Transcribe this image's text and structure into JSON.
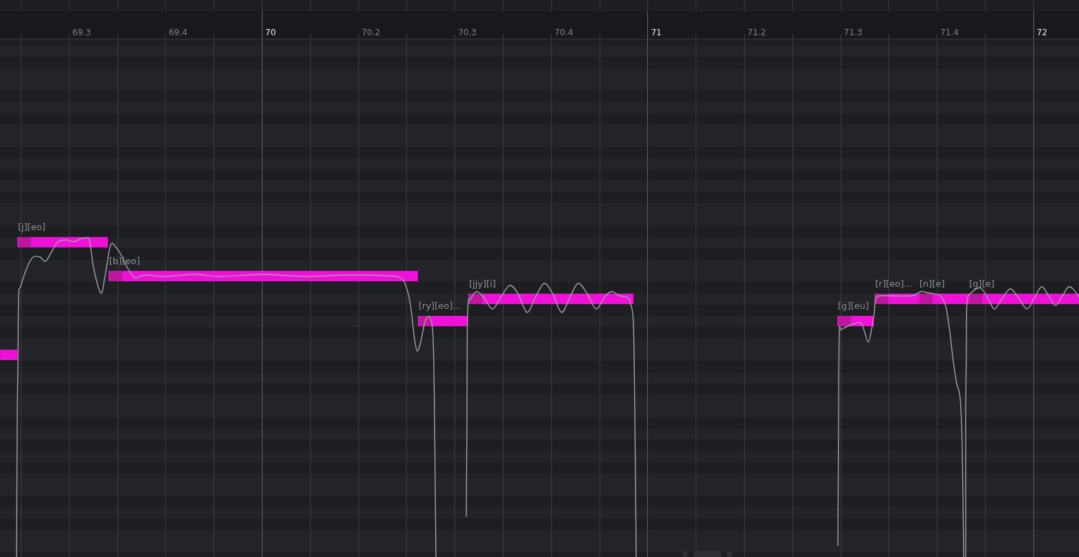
{
  "ruler": {
    "labels": [
      {
        "text": "69.3",
        "kind": "beat"
      },
      {
        "text": "69.4",
        "kind": "beat"
      },
      {
        "text": "70",
        "kind": "bar"
      },
      {
        "text": "70.2",
        "kind": "beat"
      },
      {
        "text": "70.3",
        "kind": "beat"
      },
      {
        "text": "70.4",
        "kind": "beat"
      },
      {
        "text": "71",
        "kind": "bar"
      },
      {
        "text": "71.2",
        "kind": "beat"
      },
      {
        "text": "71.3",
        "kind": "beat"
      },
      {
        "text": "71.4",
        "kind": "beat"
      },
      {
        "text": "72",
        "kind": "bar"
      }
    ]
  },
  "notes": [
    {
      "kind": "note"
    },
    {
      "kind": "note",
      "lyric": "[j][eo]"
    },
    {
      "kind": "note",
      "lyric": "[b][eo]"
    },
    {
      "kind": "note",
      "lyric": "[ry][eo]…"
    },
    {
      "kind": "note",
      "lyric": "[jjy][i]"
    },
    {
      "kind": "note",
      "lyric": "[g][eu]"
    },
    {
      "kind": "note",
      "lyric": "[r][eo]…"
    },
    {
      "kind": "note",
      "lyric": "[n][e]"
    },
    {
      "kind": "note",
      "lyric": "[g][e]"
    }
  ]
}
